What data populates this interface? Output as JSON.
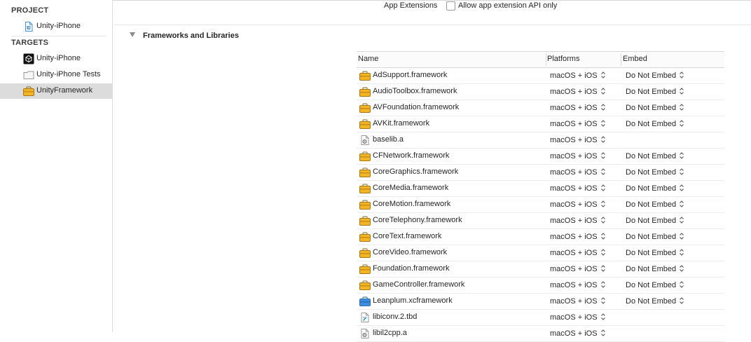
{
  "sidebar": {
    "project_header": "PROJECT",
    "project_item": "Unity-iPhone",
    "targets_header": "TARGETS",
    "targets": [
      {
        "label": "Unity-iPhone",
        "icon": "unity-app-icon"
      },
      {
        "label": "Unity-iPhone Tests",
        "icon": "test-bundle-icon"
      },
      {
        "label": "UnityFramework",
        "icon": "framework-toolbox-icon"
      }
    ]
  },
  "app_extensions": {
    "label": "App Extensions",
    "checkbox_label": "Allow app extension API only",
    "checked": false
  },
  "section": {
    "title": "Frameworks and Libraries"
  },
  "table": {
    "columns": [
      "Name",
      "Platforms",
      "Embed"
    ],
    "rows": [
      {
        "name": "AdSupport.framework",
        "platforms": "macOS + iOS",
        "embed": "Do Not Embed",
        "icon": "framework-icon"
      },
      {
        "name": "AudioToolbox.framework",
        "platforms": "macOS + iOS",
        "embed": "Do Not Embed",
        "icon": "framework-icon"
      },
      {
        "name": "AVFoundation.framework",
        "platforms": "macOS + iOS",
        "embed": "Do Not Embed",
        "icon": "framework-icon"
      },
      {
        "name": "AVKit.framework",
        "platforms": "macOS + iOS",
        "embed": "Do Not Embed",
        "icon": "framework-icon"
      },
      {
        "name": "baselib.a",
        "platforms": "macOS + iOS",
        "embed": "",
        "icon": "static-library-icon"
      },
      {
        "name": "CFNetwork.framework",
        "platforms": "macOS + iOS",
        "embed": "Do Not Embed",
        "icon": "framework-icon"
      },
      {
        "name": "CoreGraphics.framework",
        "platforms": "macOS + iOS",
        "embed": "Do Not Embed",
        "icon": "framework-icon"
      },
      {
        "name": "CoreMedia.framework",
        "platforms": "macOS + iOS",
        "embed": "Do Not Embed",
        "icon": "framework-icon"
      },
      {
        "name": "CoreMotion.framework",
        "platforms": "macOS + iOS",
        "embed": "Do Not Embed",
        "icon": "framework-icon"
      },
      {
        "name": "CoreTelephony.framework",
        "platforms": "macOS + iOS",
        "embed": "Do Not Embed",
        "icon": "framework-icon"
      },
      {
        "name": "CoreText.framework",
        "platforms": "macOS + iOS",
        "embed": "Do Not Embed",
        "icon": "framework-icon"
      },
      {
        "name": "CoreVideo.framework",
        "platforms": "macOS + iOS",
        "embed": "Do Not Embed",
        "icon": "framework-icon"
      },
      {
        "name": "Foundation.framework",
        "platforms": "macOS + iOS",
        "embed": "Do Not Embed",
        "icon": "framework-icon"
      },
      {
        "name": "GameController.framework",
        "platforms": "macOS + iOS",
        "embed": "Do Not Embed",
        "icon": "framework-icon"
      },
      {
        "name": "Leanplum.xcframework",
        "platforms": "macOS + iOS",
        "embed": "Do Not Embed",
        "icon": "xcframework-icon"
      },
      {
        "name": "libiconv.2.tbd",
        "platforms": "macOS + iOS",
        "embed": "",
        "icon": "tbd-file-icon"
      },
      {
        "name": "libil2cpp.a",
        "platforms": "macOS + iOS",
        "embed": "",
        "icon": "static-library-icon"
      }
    ]
  },
  "colors": {
    "selection": "#dcdcdc",
    "framework_yellow": "#f3b526",
    "xcframework_blue": "#3c8fe0"
  }
}
